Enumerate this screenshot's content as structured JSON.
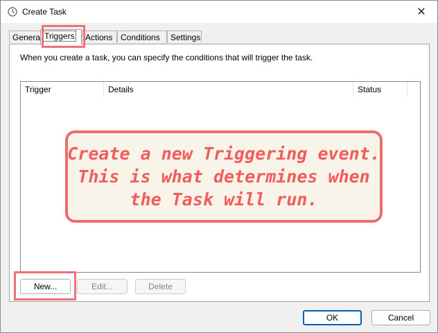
{
  "window": {
    "title": "Create Task",
    "close_glyph": "✕"
  },
  "tabs": [
    {
      "label": "General"
    },
    {
      "label": "Triggers",
      "active": true
    },
    {
      "label": "Actions"
    },
    {
      "label": "Conditions"
    },
    {
      "label": "Settings"
    }
  ],
  "triggers": {
    "description": "When you create a task, you can specify the conditions that will trigger the task.",
    "columns": [
      "Trigger",
      "Details",
      "Status"
    ],
    "rows": [],
    "buttons": {
      "new": "New...",
      "edit": "Edit...",
      "delete": "Delete"
    }
  },
  "footer": {
    "ok": "OK",
    "cancel": "Cancel"
  },
  "annotation": {
    "lines": [
      "Create a new Triggering event.",
      "This is what determines when",
      "the Task will run."
    ],
    "color": "#f06b6b"
  }
}
